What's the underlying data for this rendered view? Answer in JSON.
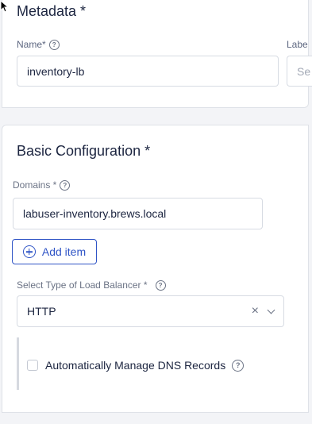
{
  "metadata": {
    "title": "Metadata *",
    "name_label": "Name*",
    "name_value": "inventory-lb",
    "labels_label": "Labe",
    "labels_placeholder": "Se"
  },
  "basic": {
    "title": "Basic Configuration *",
    "domains_label": "Domains *",
    "domain_value": "labuser-inventory.brews.local",
    "add_item_label": "Add item",
    "lb_type_label": "Select Type of Load Balancer *",
    "lb_type_value": "HTTP",
    "dns_checkbox_label": "Automatically Manage DNS Records",
    "dns_checked": false
  },
  "icons": {
    "help": "help-circle-icon",
    "add": "plus-circle-icon",
    "clear": "close-icon",
    "dropdown": "chevron-down-icon"
  },
  "colors": {
    "accent": "#2f54c6",
    "text": "#1c2540",
    "muted": "#6b7385"
  }
}
